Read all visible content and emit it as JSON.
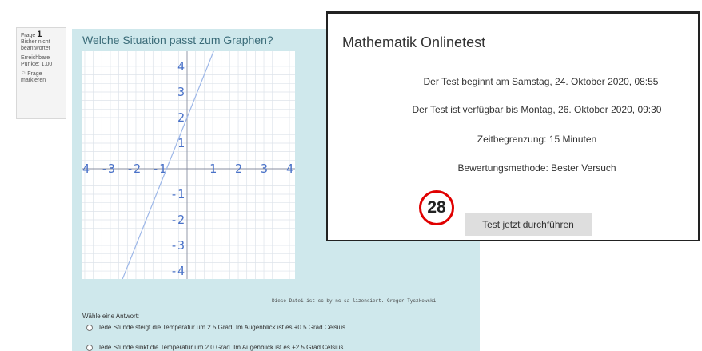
{
  "question_info": {
    "frage_label": "Frage",
    "frage_number": "1",
    "status": "Bisher nicht beantwortet",
    "points": "Erreichbare Punkte: 1,00",
    "flag_label": "Frage markieren"
  },
  "question": {
    "title": "Welche Situation passt zum Graphen?",
    "x_ticks": [
      "-4",
      "-3",
      "-2",
      "-1",
      "1",
      "2",
      "3",
      "4"
    ],
    "y_ticks_pos": [
      "4",
      "3",
      "2",
      "1"
    ],
    "y_ticks_neg": [
      "-1",
      "-2",
      "-3",
      "-4"
    ],
    "line_color": "#9db7e8",
    "credit": "Diese Datei ist cc-by-nc-sa lizensiert. Gregor Tyczkowski",
    "answer_label": "Wähle eine Antwort:",
    "options": [
      "Jede Stunde steigt die Temperatur um 2.5 Grad. Im Augenblick ist es +0.5 Grad Celsius.",
      "Jede Stunde sinkt die Temperatur um 2.0 Grad. Im Augenblick ist es +2.5 Grad Celsius."
    ]
  },
  "popup": {
    "title": "Mathematik Onlinetest",
    "line1": "Der Test beginnt am Samstag, 24. Oktober 2020, 08:55",
    "line2": "Der Test ist verfügbar bis Montag, 26. Oktober 2020, 09:30",
    "line3": "Zeitbegrenzung: 15 Minuten",
    "line4": "Bewertungsmethode: Bester Versuch",
    "button_label": "Test jetzt durchführen"
  },
  "annotation": {
    "badge_number": "28",
    "badge_color": "#e00000"
  }
}
